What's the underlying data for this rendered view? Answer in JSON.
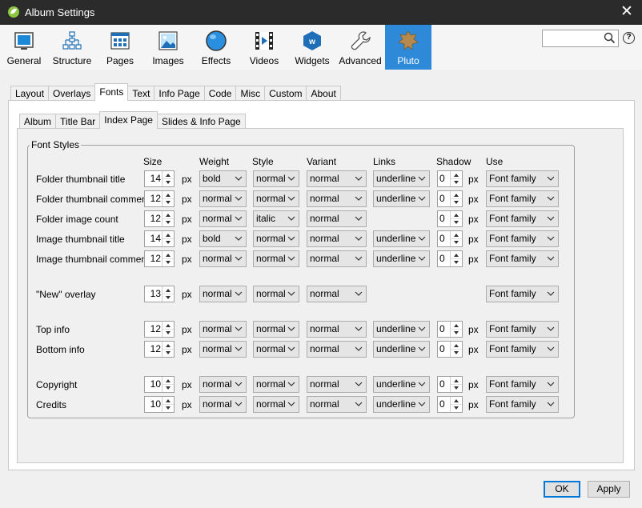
{
  "window": {
    "title": "Album Settings"
  },
  "toolbar": {
    "items": [
      {
        "label": "General",
        "icon": "monitor-icon"
      },
      {
        "label": "Structure",
        "icon": "tree-icon"
      },
      {
        "label": "Pages",
        "icon": "pages-icon"
      },
      {
        "label": "Images",
        "icon": "image-icon"
      },
      {
        "label": "Effects",
        "icon": "sphere-icon"
      },
      {
        "label": "Videos",
        "icon": "film-icon"
      },
      {
        "label": "Widgets",
        "icon": "widget-hexagon-icon"
      },
      {
        "label": "Advanced",
        "icon": "wrench-icon"
      },
      {
        "label": "Pluto",
        "icon": "pluto-skin-icon"
      }
    ],
    "active_color": "#2e8ad8"
  },
  "search": {
    "value": "",
    "placeholder": ""
  },
  "help_label": "?",
  "tabs": [
    "Layout",
    "Overlays",
    "Fonts",
    "Text",
    "Info Page",
    "Code",
    "Misc",
    "Custom",
    "About"
  ],
  "active_tab": "Fonts",
  "subtabs": [
    "Album",
    "Title Bar",
    "Index Page",
    "Slides & Info Page"
  ],
  "active_subtab": "Index Page",
  "font_styles": {
    "legend": "Font Styles",
    "columns": {
      "size": "Size",
      "weight": "Weight",
      "style": "Style",
      "variant": "Variant",
      "links": "Links",
      "shadow": "Shadow",
      "use": "Use"
    },
    "unit": "px",
    "rows": [
      {
        "label": "Folder thumbnail title",
        "size": "14",
        "weight": "bold",
        "style": "normal",
        "variant": "normal",
        "links": "underline",
        "shadow": "0",
        "use": "Font family"
      },
      {
        "label": "Folder thumbnail comment",
        "size": "12",
        "weight": "normal",
        "style": "normal",
        "variant": "normal",
        "links": "underline",
        "shadow": "0",
        "use": "Font family"
      },
      {
        "label": "Folder image count",
        "size": "12",
        "weight": "normal",
        "style": "italic",
        "variant": "normal",
        "links": null,
        "shadow": "0",
        "use": "Font family"
      },
      {
        "label": "Image thumbnail title",
        "size": "14",
        "weight": "bold",
        "style": "normal",
        "variant": "normal",
        "links": "underline",
        "shadow": "0",
        "use": "Font family"
      },
      {
        "label": "Image thumbnail comment",
        "size": "12",
        "weight": "normal",
        "style": "normal",
        "variant": "normal",
        "links": "underline",
        "shadow": "0",
        "use": "Font family"
      },
      {
        "label": "\"New\" overlay",
        "size": "13",
        "weight": "normal",
        "style": "normal",
        "variant": "normal",
        "links": null,
        "shadow": null,
        "use": "Font family"
      },
      {
        "label": "Top info",
        "size": "12",
        "weight": "normal",
        "style": "normal",
        "variant": "normal",
        "links": "underline",
        "shadow": "0",
        "use": "Font family"
      },
      {
        "label": "Bottom info",
        "size": "12",
        "weight": "normal",
        "style": "normal",
        "variant": "normal",
        "links": "underline",
        "shadow": "0",
        "use": "Font family"
      },
      {
        "label": "Copyright",
        "size": "10",
        "weight": "normal",
        "style": "normal",
        "variant": "normal",
        "links": "underline",
        "shadow": "0",
        "use": "Font family"
      },
      {
        "label": "Credits",
        "size": "10",
        "weight": "normal",
        "style": "normal",
        "variant": "normal",
        "links": "underline",
        "shadow": "0",
        "use": "Font family"
      }
    ]
  },
  "buttons": {
    "ok": "OK",
    "apply": "Apply"
  }
}
